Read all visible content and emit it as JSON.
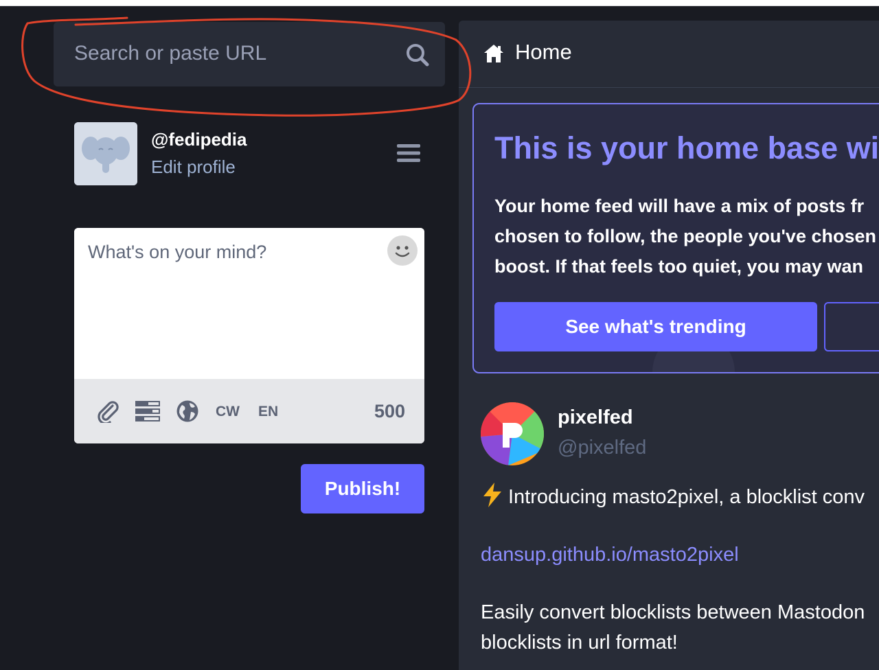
{
  "search": {
    "placeholder": "Search or paste URL"
  },
  "profile": {
    "handle": "@fedipedia",
    "edit_label": "Edit profile"
  },
  "compose": {
    "placeholder": "What's on your mind?",
    "cw_label": "CW",
    "lang_label": "EN",
    "char_count": "500",
    "publish_label": "Publish!"
  },
  "column": {
    "title": "Home"
  },
  "banner": {
    "title": "This is your home base withi",
    "lines": [
      "Your home feed will have a mix of posts fr",
      "chosen to follow, the people you've chosen",
      "boost. If that feels too quiet, you may wan"
    ],
    "trending_label": "See what's trending"
  },
  "status": {
    "display_name": "pixelfed",
    "acct": "@pixelfed",
    "intro": "Introducing masto2pixel, a blocklist conv",
    "link": "dansup.github.io/masto2pixel",
    "body_lines": [
      "Easily convert blocklists between Mastodon",
      "blocklists in url format!"
    ]
  },
  "colors": {
    "accent": "#6364ff",
    "accent_light": "#8c8dff",
    "background": "#191b22",
    "panel": "#282c37",
    "annotation": "#e0432b"
  },
  "icons": [
    "search-icon",
    "hamburger-menu-icon",
    "emoji-icon",
    "paperclip-icon",
    "poll-icon",
    "globe-icon",
    "home-icon",
    "lightning-bolt-icon"
  ]
}
